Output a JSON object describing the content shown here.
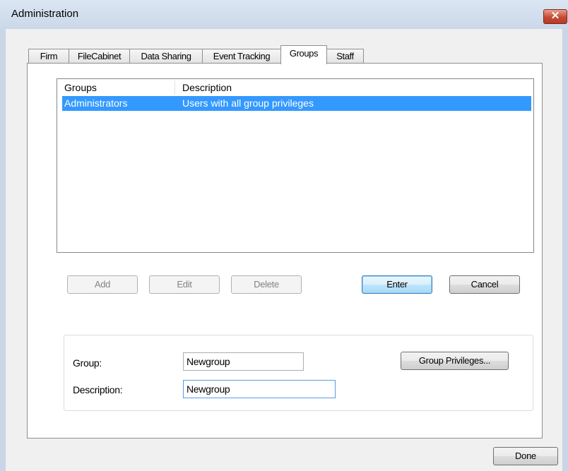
{
  "window": {
    "title": "Administration",
    "close_glyph": "✕"
  },
  "tabs": [
    {
      "label": "Firm"
    },
    {
      "label": "FileCabinet"
    },
    {
      "label": "Data Sharing"
    },
    {
      "label": "Event Tracking"
    },
    {
      "label": "Groups",
      "active": true
    },
    {
      "label": "Staff"
    }
  ],
  "list": {
    "columns": [
      "Groups",
      "Description"
    ],
    "rows": [
      {
        "group": "Administrators",
        "description": "Users with all group privileges",
        "selected": true
      }
    ]
  },
  "buttons": {
    "add": "Add",
    "edit": "Edit",
    "delete": "Delete",
    "enter": "Enter",
    "cancel": "Cancel",
    "group_privileges": "Group Privileges...",
    "done": "Done"
  },
  "form": {
    "group_label": "Group:",
    "group_value": "Newgroup",
    "description_label": "Description:",
    "description_value": "Newgroup"
  },
  "colors": {
    "selection": "#3399ff",
    "close_button": "#c74a35",
    "frame": "#c9d6e6"
  }
}
